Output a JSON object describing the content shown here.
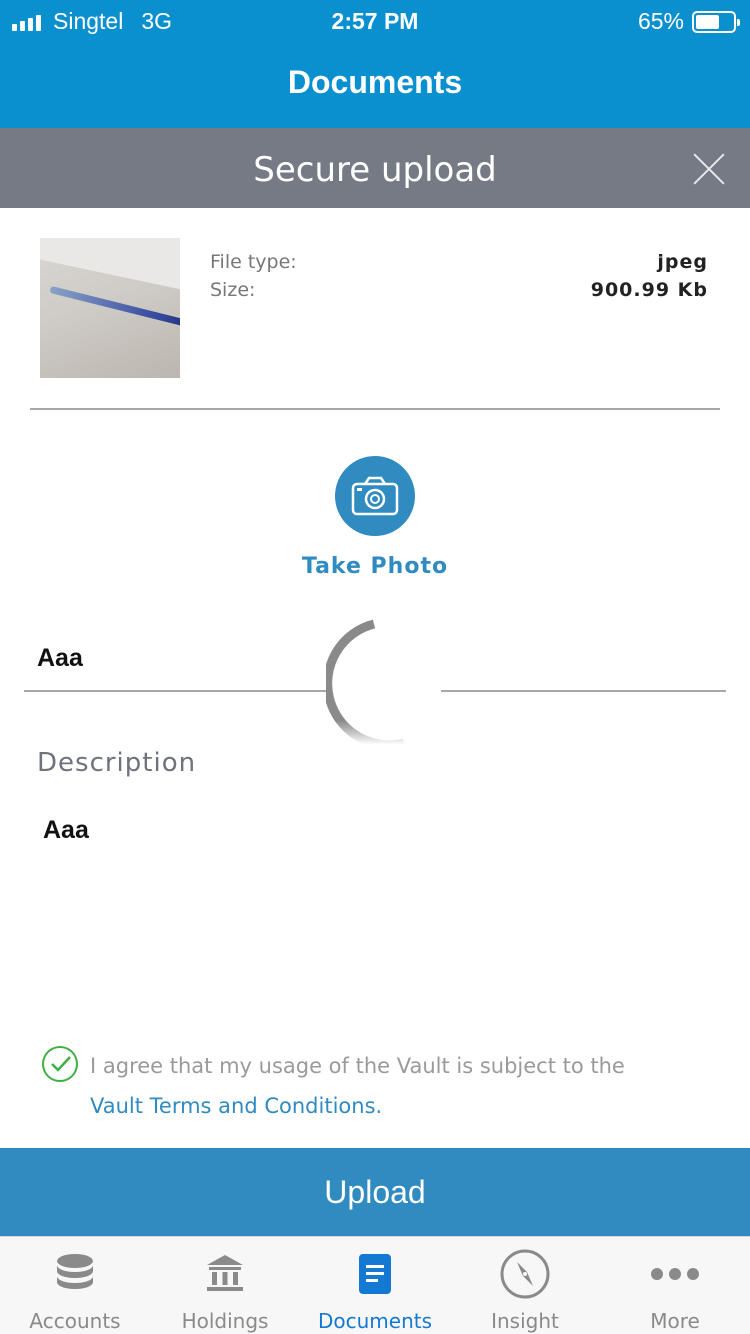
{
  "status_bar": {
    "carrier": "Singtel",
    "network": "3G",
    "time": "2:57 PM",
    "battery_percent": "65%",
    "battery_level": 0.65
  },
  "nav": {
    "title": "Documents"
  },
  "modal": {
    "title": "Secure upload",
    "close_icon": "close-icon"
  },
  "file": {
    "type_label": "File type:",
    "size_label": "Size:",
    "type_value": "jpeg",
    "size_value": "900.99 Kb"
  },
  "take_photo": {
    "label": "Take Photo",
    "icon": "camera-icon"
  },
  "form": {
    "title_value": "Aaa",
    "description_label": "Description",
    "description_value": "Aaa"
  },
  "agreement": {
    "text": "I agree that my usage of the Vault is subject to the",
    "link": "Vault Terms and Conditions.",
    "checked": true
  },
  "upload_button": "Upload",
  "tabs": [
    {
      "label": "Accounts",
      "icon": "database-icon",
      "active": false
    },
    {
      "label": "Holdings",
      "icon": "bank-icon",
      "active": false
    },
    {
      "label": "Documents",
      "icon": "document-icon",
      "active": true
    },
    {
      "label": "Insight",
      "icon": "compass-icon",
      "active": false
    },
    {
      "label": "More",
      "icon": "more-icon",
      "active": false
    }
  ],
  "colors": {
    "nav_blue": "#0a8fcf",
    "modal_gray": "#757a85",
    "accent": "#2f8bc0",
    "check_green": "#3fb143",
    "tab_active": "#1479d2"
  }
}
